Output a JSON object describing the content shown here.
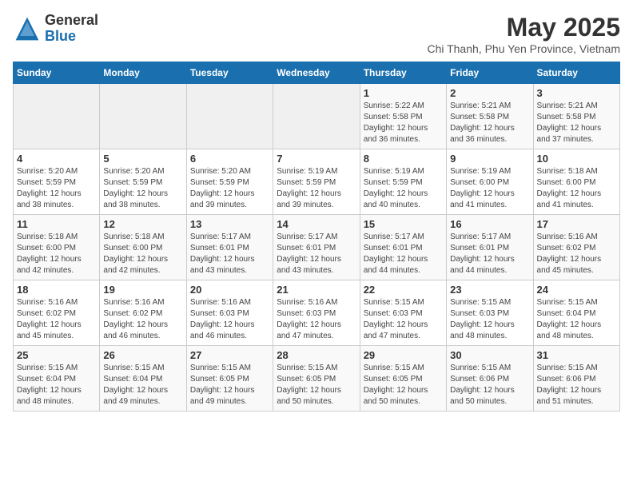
{
  "logo": {
    "general": "General",
    "blue": "Blue"
  },
  "title": "May 2025",
  "subtitle": "Chi Thanh, Phu Yen Province, Vietnam",
  "calendar": {
    "headers": [
      "Sunday",
      "Monday",
      "Tuesday",
      "Wednesday",
      "Thursday",
      "Friday",
      "Saturday"
    ],
    "weeks": [
      [
        {
          "day": "",
          "info": ""
        },
        {
          "day": "",
          "info": ""
        },
        {
          "day": "",
          "info": ""
        },
        {
          "day": "",
          "info": ""
        },
        {
          "day": "1",
          "info": "Sunrise: 5:22 AM\nSunset: 5:58 PM\nDaylight: 12 hours\nand 36 minutes."
        },
        {
          "day": "2",
          "info": "Sunrise: 5:21 AM\nSunset: 5:58 PM\nDaylight: 12 hours\nand 36 minutes."
        },
        {
          "day": "3",
          "info": "Sunrise: 5:21 AM\nSunset: 5:58 PM\nDaylight: 12 hours\nand 37 minutes."
        }
      ],
      [
        {
          "day": "4",
          "info": "Sunrise: 5:20 AM\nSunset: 5:59 PM\nDaylight: 12 hours\nand 38 minutes."
        },
        {
          "day": "5",
          "info": "Sunrise: 5:20 AM\nSunset: 5:59 PM\nDaylight: 12 hours\nand 38 minutes."
        },
        {
          "day": "6",
          "info": "Sunrise: 5:20 AM\nSunset: 5:59 PM\nDaylight: 12 hours\nand 39 minutes."
        },
        {
          "day": "7",
          "info": "Sunrise: 5:19 AM\nSunset: 5:59 PM\nDaylight: 12 hours\nand 39 minutes."
        },
        {
          "day": "8",
          "info": "Sunrise: 5:19 AM\nSunset: 5:59 PM\nDaylight: 12 hours\nand 40 minutes."
        },
        {
          "day": "9",
          "info": "Sunrise: 5:19 AM\nSunset: 6:00 PM\nDaylight: 12 hours\nand 41 minutes."
        },
        {
          "day": "10",
          "info": "Sunrise: 5:18 AM\nSunset: 6:00 PM\nDaylight: 12 hours\nand 41 minutes."
        }
      ],
      [
        {
          "day": "11",
          "info": "Sunrise: 5:18 AM\nSunset: 6:00 PM\nDaylight: 12 hours\nand 42 minutes."
        },
        {
          "day": "12",
          "info": "Sunrise: 5:18 AM\nSunset: 6:00 PM\nDaylight: 12 hours\nand 42 minutes."
        },
        {
          "day": "13",
          "info": "Sunrise: 5:17 AM\nSunset: 6:01 PM\nDaylight: 12 hours\nand 43 minutes."
        },
        {
          "day": "14",
          "info": "Sunrise: 5:17 AM\nSunset: 6:01 PM\nDaylight: 12 hours\nand 43 minutes."
        },
        {
          "day": "15",
          "info": "Sunrise: 5:17 AM\nSunset: 6:01 PM\nDaylight: 12 hours\nand 44 minutes."
        },
        {
          "day": "16",
          "info": "Sunrise: 5:17 AM\nSunset: 6:01 PM\nDaylight: 12 hours\nand 44 minutes."
        },
        {
          "day": "17",
          "info": "Sunrise: 5:16 AM\nSunset: 6:02 PM\nDaylight: 12 hours\nand 45 minutes."
        }
      ],
      [
        {
          "day": "18",
          "info": "Sunrise: 5:16 AM\nSunset: 6:02 PM\nDaylight: 12 hours\nand 45 minutes."
        },
        {
          "day": "19",
          "info": "Sunrise: 5:16 AM\nSunset: 6:02 PM\nDaylight: 12 hours\nand 46 minutes."
        },
        {
          "day": "20",
          "info": "Sunrise: 5:16 AM\nSunset: 6:03 PM\nDaylight: 12 hours\nand 46 minutes."
        },
        {
          "day": "21",
          "info": "Sunrise: 5:16 AM\nSunset: 6:03 PM\nDaylight: 12 hours\nand 47 minutes."
        },
        {
          "day": "22",
          "info": "Sunrise: 5:15 AM\nSunset: 6:03 PM\nDaylight: 12 hours\nand 47 minutes."
        },
        {
          "day": "23",
          "info": "Sunrise: 5:15 AM\nSunset: 6:03 PM\nDaylight: 12 hours\nand 48 minutes."
        },
        {
          "day": "24",
          "info": "Sunrise: 5:15 AM\nSunset: 6:04 PM\nDaylight: 12 hours\nand 48 minutes."
        }
      ],
      [
        {
          "day": "25",
          "info": "Sunrise: 5:15 AM\nSunset: 6:04 PM\nDaylight: 12 hours\nand 48 minutes."
        },
        {
          "day": "26",
          "info": "Sunrise: 5:15 AM\nSunset: 6:04 PM\nDaylight: 12 hours\nand 49 minutes."
        },
        {
          "day": "27",
          "info": "Sunrise: 5:15 AM\nSunset: 6:05 PM\nDaylight: 12 hours\nand 49 minutes."
        },
        {
          "day": "28",
          "info": "Sunrise: 5:15 AM\nSunset: 6:05 PM\nDaylight: 12 hours\nand 50 minutes."
        },
        {
          "day": "29",
          "info": "Sunrise: 5:15 AM\nSunset: 6:05 PM\nDaylight: 12 hours\nand 50 minutes."
        },
        {
          "day": "30",
          "info": "Sunrise: 5:15 AM\nSunset: 6:06 PM\nDaylight: 12 hours\nand 50 minutes."
        },
        {
          "day": "31",
          "info": "Sunrise: 5:15 AM\nSunset: 6:06 PM\nDaylight: 12 hours\nand 51 minutes."
        }
      ]
    ]
  }
}
